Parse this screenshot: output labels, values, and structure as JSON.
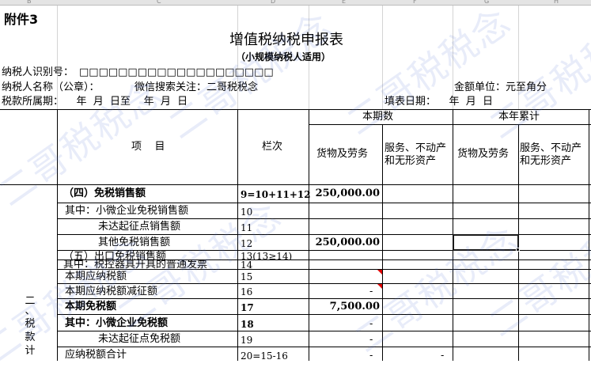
{
  "sheet": {
    "attachment_label": "附件3",
    "title": "增值税纳税申报表",
    "subtitle": "（小规模纳税人适用）",
    "taxpayer_id_label": "纳税人识别号：",
    "taxpayer_id_boxes": "□□□□□□□□□□□□□□□□□□□□",
    "taxpayer_name_label": "纳税人名称（公章）：",
    "wechat_note": "微信搜索关注：二哥税税念",
    "currency_unit": "金额单位：元至角分",
    "tax_period": "税款所属期：    年  月  日至    年  月  日",
    "fill_date": "填表日期：    年  月  日",
    "watermark": "二哥税税念"
  },
  "headers": {
    "item": "项    目",
    "column": "栏次",
    "current_period": "本期数",
    "year_total": "本年累计",
    "goods_services": "货物及劳务",
    "services_realestate_line1": "服务、不动产",
    "services_realestate_line2": "和无形资产",
    "goods_services_2": "货物及劳务",
    "services_realestate2_line1": "服务、不动产",
    "services_realestate2_line2": "和无形资产"
  },
  "section_label": {
    "c1": "二",
    "c2": "、",
    "c3": "税",
    "c4": "款",
    "c5": "计"
  },
  "rows": [
    {
      "item": "（四）免税销售额",
      "col": "9=10+11+12",
      "goods": "250,000.00"
    },
    {
      "item": "其中：小微企业免税销售额",
      "col": "10",
      "goods": ""
    },
    {
      "item": "未达起征点销售额",
      "col": "11",
      "goods": ""
    },
    {
      "item": "其他免税销售额",
      "col": "12",
      "goods": "250,000.00"
    },
    {
      "item": "（五）出口免税销售额",
      "col": "13(13≥14)",
      "goods": ""
    },
    {
      "item": "其中：税控器具开具的普通发票",
      "col": "14",
      "goods": ""
    },
    {
      "item": "本期应纳税额",
      "col": "15",
      "goods": ""
    },
    {
      "item": "本期应纳税额减征额",
      "col": "16",
      "goods": "-"
    },
    {
      "item": "本期免税额",
      "col": "17",
      "goods": "7,500.00"
    },
    {
      "item": "其中：小微企业免税额",
      "col": "18",
      "goods": "-"
    },
    {
      "item": "未达起征点免税额",
      "col": "19",
      "goods": "-"
    },
    {
      "item": "应纳税额合计",
      "col": "20=15-16",
      "goods": "-",
      "services": "-"
    }
  ],
  "colors": {
    "watermark": "#506ed2",
    "header_bg": "#e4e4e4",
    "comment_marker": "#e00000"
  }
}
